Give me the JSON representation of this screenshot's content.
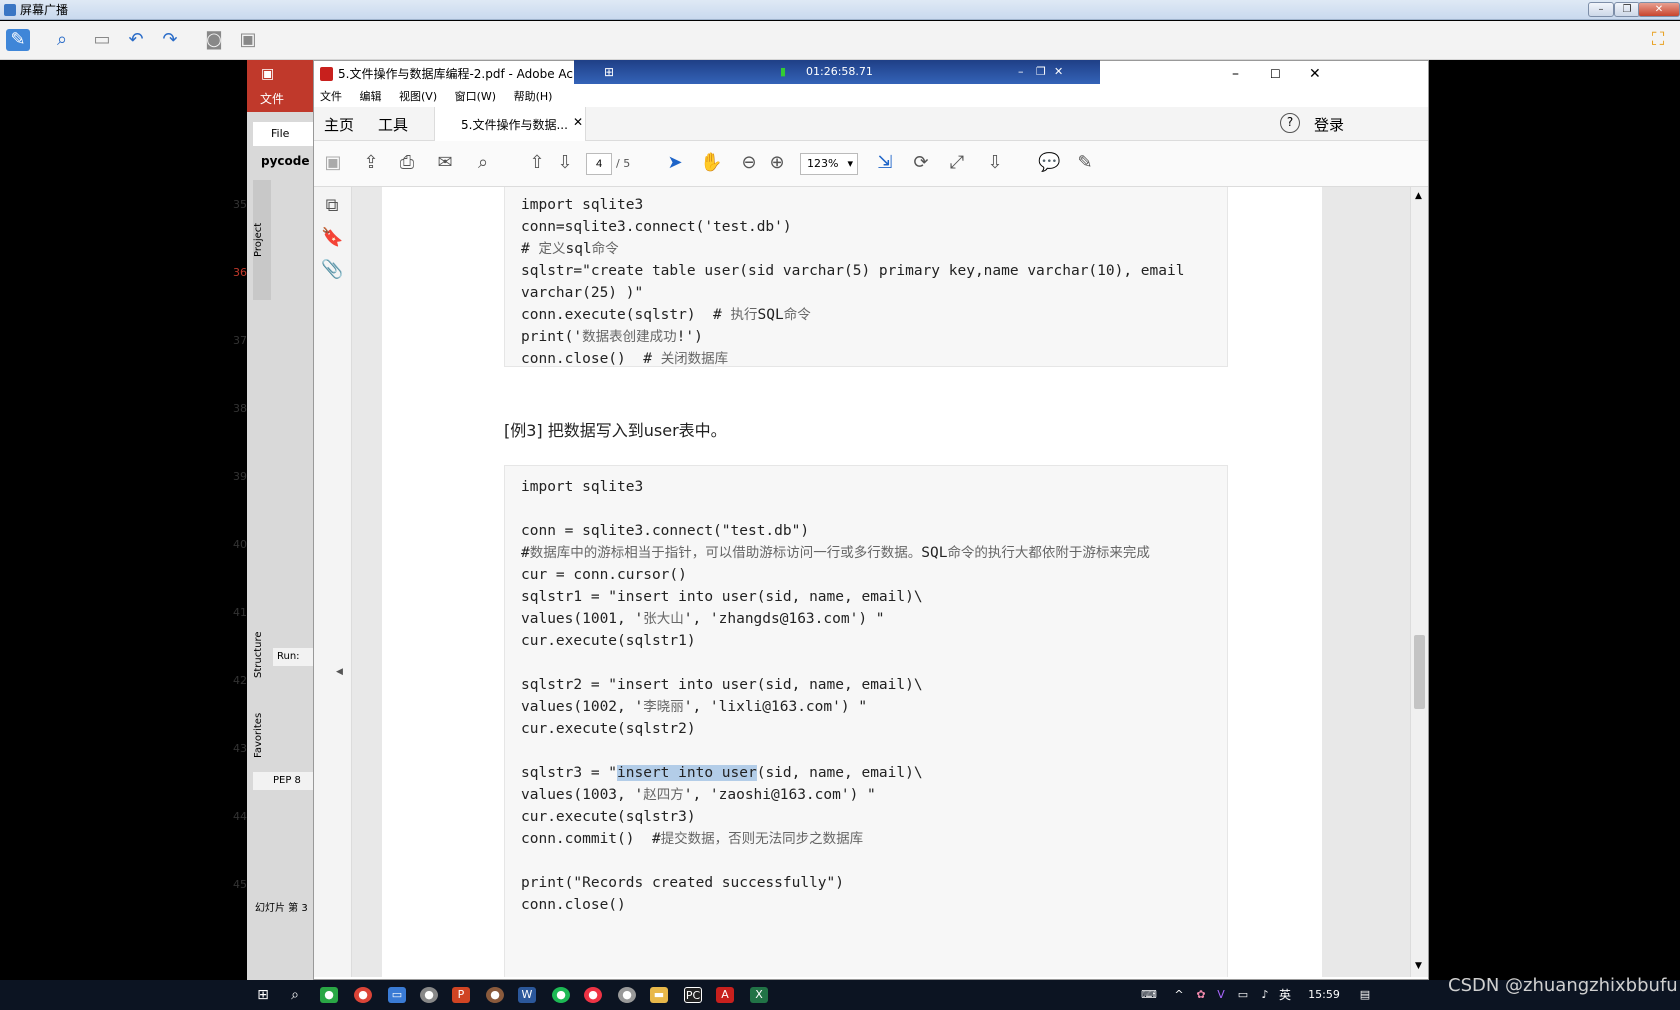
{
  "outer_app": {
    "title": "屏幕广播"
  },
  "ppt": {
    "file_label": "文件",
    "pycode_label": "pycode",
    "file_menu": "File",
    "project_tab": "Project",
    "structure_tab": "Structure",
    "favorites_tab": "Favorites",
    "run_label": "Run:",
    "pep_label": "PEP 8",
    "slide_numbers": [
      "35",
      "36",
      "37",
      "38",
      "39",
      "40",
      "41",
      "42",
      "43",
      "44",
      "45"
    ],
    "status": "幻灯片 第 3"
  },
  "recording": {
    "timer": "01:26:58.71"
  },
  "acrobat": {
    "title": "5.文件操作与数据库编程-2.pdf - Adobe Acrobat",
    "menu": [
      "文件",
      "编辑",
      "视图(V)",
      "窗口(W)",
      "帮助(H)"
    ],
    "tab_home": "主页",
    "tab_tools": "工具",
    "doc_tab": "5.文件操作与数据...",
    "login": "登录",
    "page_current": "4",
    "page_total": "/ 5",
    "zoom": "123%"
  },
  "document": {
    "code1": [
      "import sqlite3",
      "conn=sqlite3.connect('test.db')",
      "# 定义sql命令",
      "sqlstr=\"create table user(sid varchar(5) primary key,name varchar(10), email",
      "varchar(25) )\"",
      "conn.execute(sqlstr)  # 执行SQL命令",
      "print('数据表创建成功!')",
      "conn.close()  # 关闭数据库"
    ],
    "heading": "[例3] 把数据写入到user表中。",
    "code2": [
      "import sqlite3",
      "",
      "conn = sqlite3.connect(\"test.db\")",
      "#数据库中的游标相当于指针，可以借助游标访问一行或多行数据。SQL命令的执行大都依附于游标来完成",
      "cur = conn.cursor()",
      "sqlstr1 = \"insert into user(sid, name, email)\\",
      "values(1001, '张大山', 'zhangds@163.com') \"",
      "cur.execute(sqlstr1)",
      "",
      "sqlstr2 = \"insert into user(sid, name, email)\\",
      "values(1002, '李晓丽', 'lixli@163.com') \"",
      "cur.execute(sqlstr2)",
      "",
      "sqlstr3 = \"insert into user(sid, name, email)\\",
      "values(1003, '赵四方', 'zaoshi@163.com') \"",
      "cur.execute(sqlstr3)",
      "conn.commit()  #提交数据，否则无法同步之数据库",
      "",
      "print(\"Records created successfully\")",
      "conn.close()"
    ],
    "highlight_text": "insert into user",
    "sqlstr3_prefix": "sqlstr3 = \"",
    "sqlstr3_suffix": "(sid, name, email)\\"
  },
  "taskbar": {
    "time": "15:59",
    "ime": "英"
  },
  "watermark": "CSDN @zhuangzhixbbufu"
}
